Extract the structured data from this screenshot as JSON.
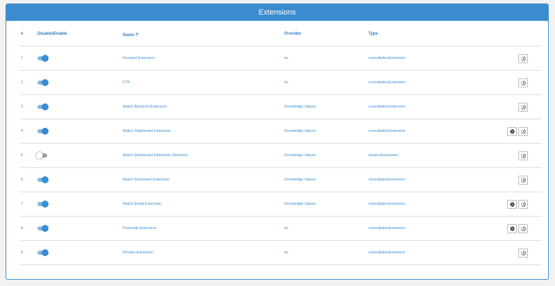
{
  "panel": {
    "title": "Extensions"
  },
  "columns": {
    "index": "#",
    "toggle": "Disable/Enable",
    "name": "Name",
    "provider": "Provider",
    "type": "Type"
  },
  "sort": {
    "column": "Name",
    "direction": "ascending",
    "icon": "arrow-up-icon"
  },
  "rows": [
    {
      "index": "1",
      "enabled": true,
      "name": "Forward Extension",
      "provider": "kv",
      "type": "consultationExtension",
      "settings": false
    },
    {
      "index": "2",
      "enabled": true,
      "name": "FTP",
      "provider": "kv",
      "type": "consultationExtension",
      "settings": false
    },
    {
      "index": "3",
      "enabled": true,
      "name": "Match Backend Extension",
      "provider": "Knowledge Values",
      "type": "consultationExtension",
      "settings": false
    },
    {
      "index": "4",
      "enabled": true,
      "name": "Match Dashboard Extension",
      "provider": "Knowledge Values",
      "type": "consultationExtension",
      "settings": true
    },
    {
      "index": "5",
      "enabled": false,
      "name": "Match Dashboard Extension (Session)",
      "provider": "Knowledge Values",
      "type": "sessionExtension",
      "settings": false
    },
    {
      "index": "6",
      "enabled": true,
      "name": "Match Document Extension",
      "provider": "Knowledge Values",
      "type": "consultationExtension",
      "settings": false
    },
    {
      "index": "7",
      "enabled": true,
      "name": "Match Email Extension",
      "provider": "Knowledge Values",
      "type": "consultationExtension",
      "settings": true
    },
    {
      "index": "8",
      "enabled": true,
      "name": "Postcode Extension",
      "provider": "kv",
      "type": "consultationExtension",
      "settings": true
    },
    {
      "index": "9",
      "enabled": true,
      "name": "Review Extension",
      "provider": "kv",
      "type": "consultationExtension",
      "settings": false
    }
  ],
  "icons": {
    "settings": "gear-icon",
    "reset": "history-icon",
    "toggle": "toggle-switch"
  },
  "colors": {
    "accent": "#3b8ccf",
    "toggle_track_on": "#7fb8e4",
    "toggle_track_off": "#9e9e9e"
  }
}
